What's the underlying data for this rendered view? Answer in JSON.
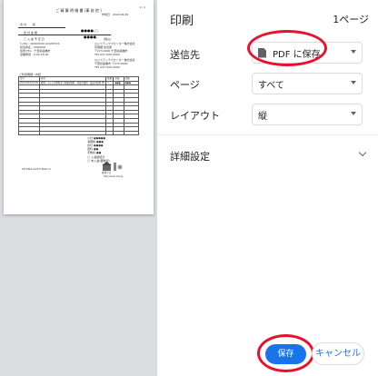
{
  "preview": {
    "title": "ご 精 算 明 細 書 (事 前 控 )",
    "page_no": "1 / 1",
    "header_label": "作成日",
    "header_date": "2021/04/16",
    "customer_line": "合 計　　 様",
    "amount_label": "合 計 金 額",
    "amount_masked": "●●●●,○",
    "sub_label": "ご 入 金 予 定 日",
    "sub_masked": "●●●●,",
    "sub_note": "(税込)",
    "left_rows": [
      "ｹｰｽNo : 00000000 LOGISTICS",
      "担当者名 : 0000000",
      "住所/TEL : 千葉県船橋市",
      "営業時間 : 9:00-18:00"
    ],
    "right_rows": [
      "ロジスティクスセンター株式会社",
      "管理課 担当者",
      "〒273-0000 千葉県船橋市",
      "TEL 047-000-0000"
    ],
    "right_rows2": [
      "ロジスティクスセンター株式会社",
      "千葉県船橋市 〒273-0000",
      "TEL 047-000-0000"
    ],
    "table_title": "ご利用明細 / 内訳",
    "table_headers": [
      "日付",
      "内容",
      "数量",
      "単価",
      "金額"
    ],
    "table_first": [
      "2021/04/16 8:00",
      "精算システム利用料金 (倉庫保管料・荷役作業料・配送手配料 等)",
      "1",
      "●●●",
      "●●●"
    ],
    "summary": [
      "小計 ●●●●●",
      "消費税 ●●●",
      "合計 ●●●●",
      "送料 ●●",
      "手数料 ●●"
    ],
    "summary_marks": [
      "◯ 入金確認済",
      "◯ 未入金(要確認)"
    ],
    "footer_left": "CE-DRA-0123-4567-A",
    "logo_text": "倉庫ナビ",
    "logo_url": "http://souko-navi.jp"
  },
  "header": {
    "title": "印刷",
    "pages": "1ページ"
  },
  "destination": {
    "label": "送信先",
    "value": "PDF に保存",
    "icon": "document-icon"
  },
  "pages": {
    "label": "ページ",
    "value": "すべて"
  },
  "layout": {
    "label": "レイアウト",
    "value": "縦"
  },
  "more_settings": {
    "label": "詳細設定"
  },
  "buttons": {
    "save": "保存",
    "cancel": "キャンセル"
  },
  "colors": {
    "primary": "#1a73e8",
    "highlight": "#e8102e",
    "preview_bg": "#dadce0"
  }
}
